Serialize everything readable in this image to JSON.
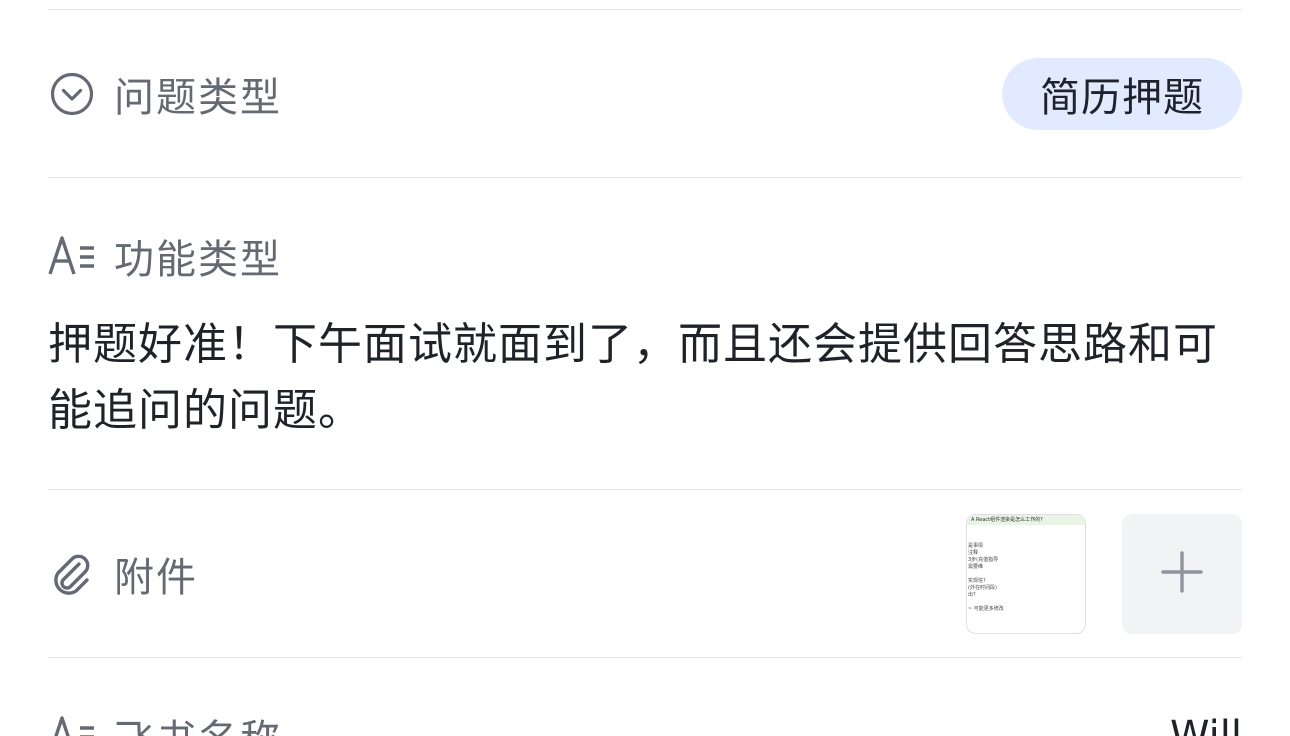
{
  "question_type": {
    "icon": "chevron-down-circle-icon",
    "label": "问题类型",
    "value": "简历押题"
  },
  "feature_type": {
    "icon": "text-format-icon",
    "label": "功能类型",
    "text": "押题好准！下午面试就面到了，而且还会提供回答思路和可能追问的问题。"
  },
  "attachment": {
    "icon": "paperclip-icon",
    "label": "附件",
    "thumbnail": {
      "header": "A  React组件渲染是怎么工作的?",
      "lines": [
        "是事情",
        "注释",
        "3步(充值指导",
        "需要维",
        "",
        "实现信?",
        "(外在时间段)",
        "出?",
        "",
        "~ 可能更多修改"
      ]
    },
    "add_icon": "plus-icon"
  },
  "next_field": {
    "icon": "text-format-icon",
    "label": "飞书名称",
    "value": "Will"
  }
}
